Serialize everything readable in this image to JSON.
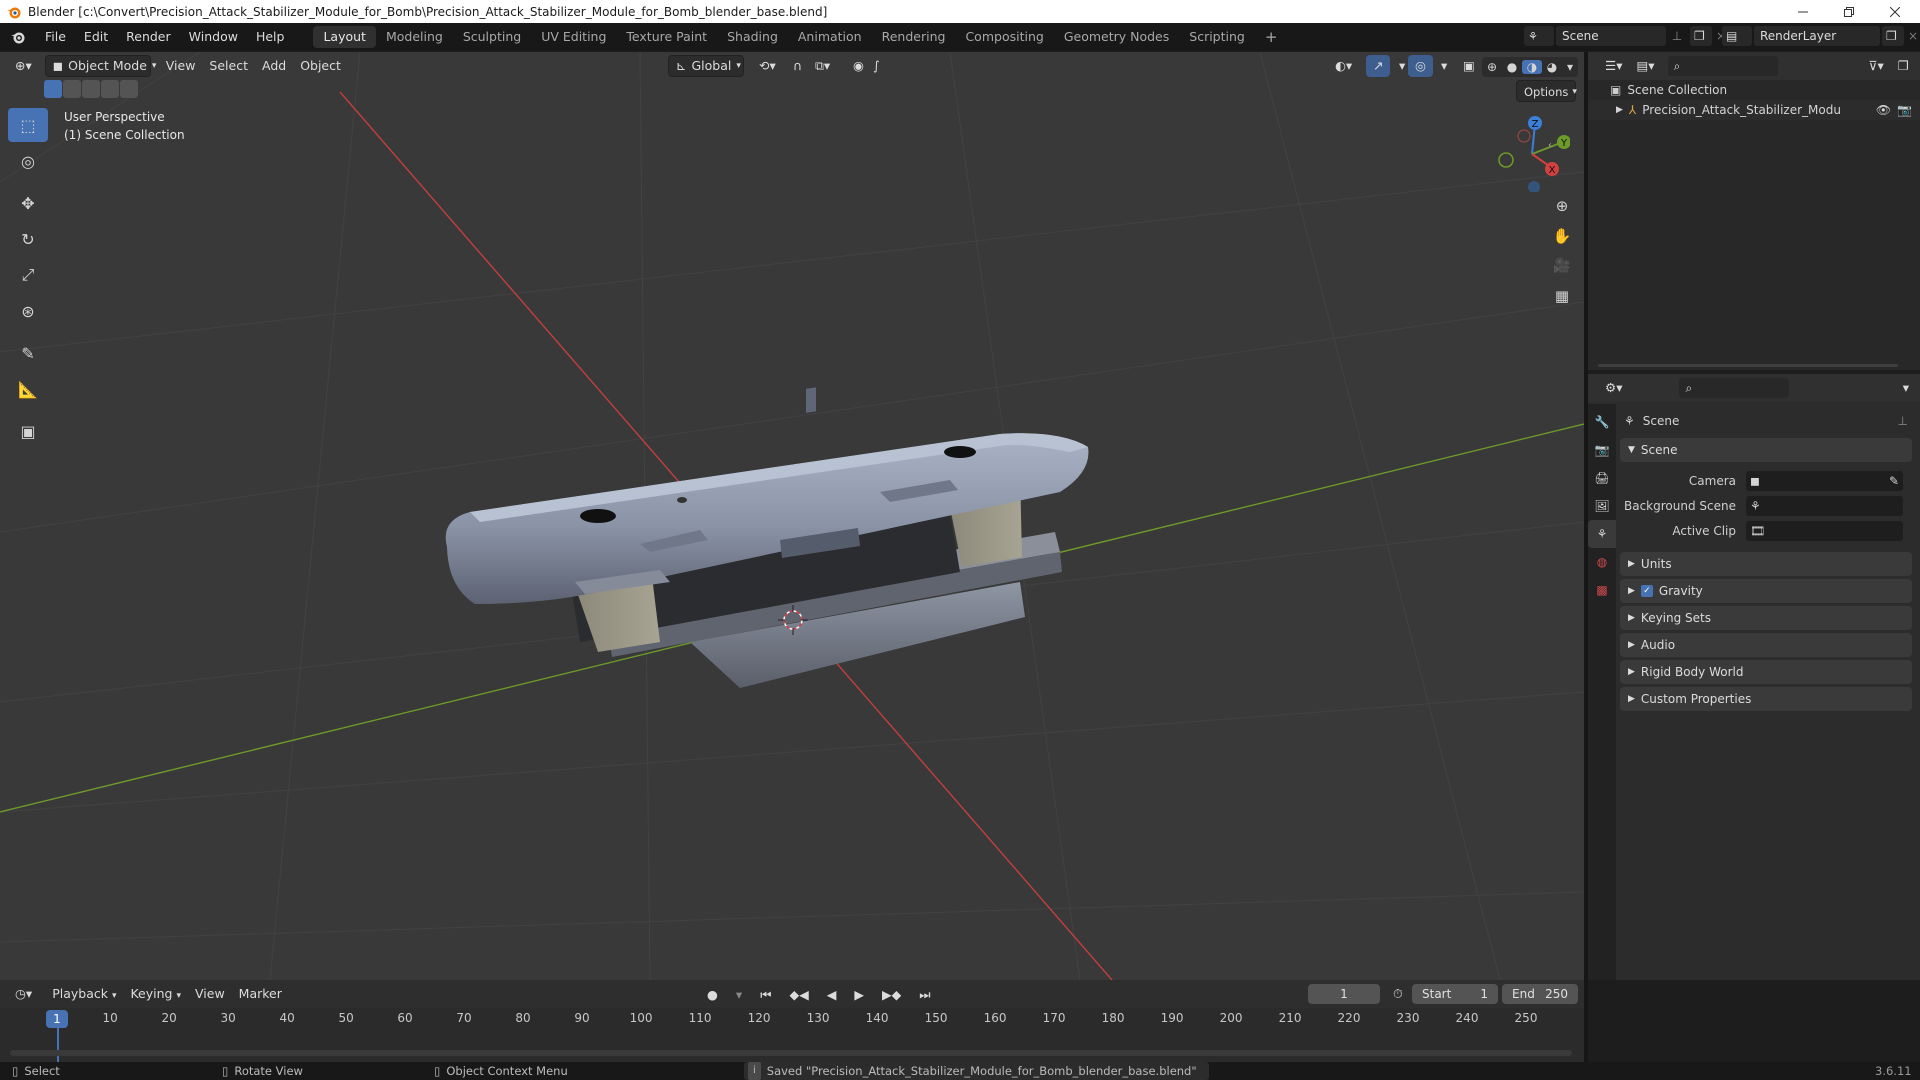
{
  "window": {
    "title": "Blender [c:\\Convert\\Precision_Attack_Stabilizer_Module_for_Bomb\\Precision_Attack_Stabilizer_Module_for_Bomb_blender_base.blend]"
  },
  "menu": {
    "file": "File",
    "edit": "Edit",
    "render": "Render",
    "window": "Window",
    "help": "Help"
  },
  "workspaces": [
    "Layout",
    "Modeling",
    "Sculpting",
    "UV Editing",
    "Texture Paint",
    "Shading",
    "Animation",
    "Rendering",
    "Compositing",
    "Geometry Nodes",
    "Scripting"
  ],
  "scene_selector": {
    "value": "Scene"
  },
  "renderlayer_selector": {
    "value": "RenderLayer"
  },
  "viewport": {
    "mode": "Object Mode",
    "menus": {
      "view": "View",
      "select": "Select",
      "add": "Add",
      "object": "Object"
    },
    "orientation": "Global",
    "options_label": "Options",
    "overlay_line1": "User Perspective",
    "overlay_line2": "(1) Scene Collection",
    "gizmo_axes": {
      "x": "X",
      "y": "Y",
      "z": "Z"
    }
  },
  "outliner": {
    "root": "Scene Collection",
    "items": [
      {
        "label": "Precision_Attack_Stabilizer_Module_for_"
      }
    ]
  },
  "properties": {
    "header_title": "Scene",
    "section_scene": "Scene",
    "camera_label": "Camera",
    "background_scene_label": "Background Scene",
    "active_clip_label": "Active Clip",
    "sections": [
      "Units",
      "Gravity",
      "Keying Sets",
      "Audio",
      "Rigid Body World",
      "Custom Properties"
    ],
    "gravity_checked": true
  },
  "timeline": {
    "menus": {
      "playback": "Playback",
      "keying": "Keying",
      "view": "View",
      "marker": "Marker"
    },
    "current_frame": "1",
    "start_label": "Start",
    "start_value": "1",
    "end_label": "End",
    "end_value": "250",
    "ruler": [
      "10",
      "20",
      "30",
      "40",
      "50",
      "60",
      "70",
      "80",
      "90",
      "100",
      "110",
      "120",
      "130",
      "140",
      "150",
      "160",
      "170",
      "180",
      "190",
      "200",
      "210",
      "220",
      "230",
      "240",
      "250"
    ],
    "playhead_label": "1"
  },
  "statusbar": {
    "select": "Select",
    "rotate": "Rotate View",
    "context": "Object Context Menu",
    "message": "Saved \"Precision_Attack_Stabilizer_Module_for_Bomb_blender_base.blend\"",
    "version": "3.6.11"
  },
  "colors": {
    "accent": "#4772b3",
    "axis_x": "#d0413f",
    "axis_y": "#6e9a2a",
    "axis_z": "#3b7fd9",
    "playhead": "#4772b3"
  }
}
